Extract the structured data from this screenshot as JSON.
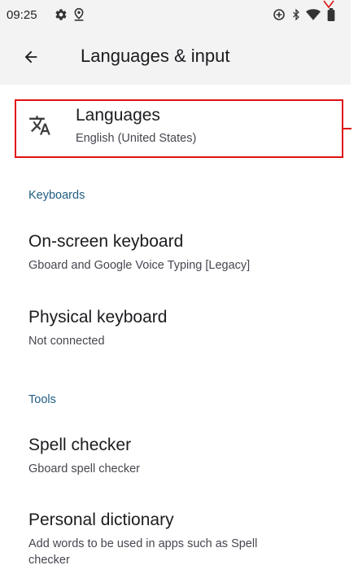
{
  "status_bar": {
    "time": "09:25",
    "icons": [
      "gear-icon",
      "location-icon",
      "data-saver-icon",
      "bluetooth-icon",
      "wifi-icon",
      "battery-icon"
    ]
  },
  "appbar": {
    "title": "Languages & input",
    "back_icon": "arrow-back-icon"
  },
  "languages": {
    "icon": "translate-icon",
    "title": "Languages",
    "subtitle": "English (United States)"
  },
  "keyboards": {
    "header": "Keyboards",
    "items": [
      {
        "title": "On-screen keyboard",
        "subtitle": "Gboard and Google Voice Typing [Legacy]"
      },
      {
        "title": "Physical keyboard",
        "subtitle": "Not connected"
      }
    ]
  },
  "tools": {
    "header": "Tools",
    "items": [
      {
        "title": "Spell checker",
        "subtitle": "Gboard spell checker"
      },
      {
        "title": "Personal dictionary",
        "subtitle": "Add words to be used in apps such as Spell checker"
      }
    ]
  },
  "colors": {
    "appbar_bg": "#f3f3f3",
    "section_header": "#1f5c80",
    "highlight": "#e01010"
  }
}
